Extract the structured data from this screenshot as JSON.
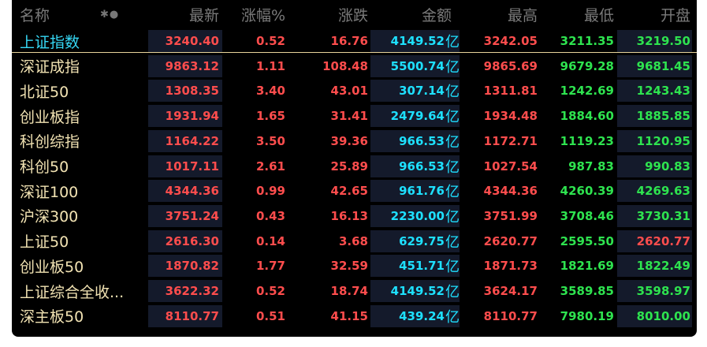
{
  "header": {
    "name": "名称",
    "toggle_icon_text": "✱●",
    "latest": "最新",
    "pct": "涨幅%",
    "change": "涨跌",
    "amount": "金额",
    "high": "最高",
    "low": "最低",
    "open": "开盘"
  },
  "unit": "亿",
  "colors": {
    "background": "#000000",
    "red": "#ff4d4d",
    "green": "#2ee34f",
    "cyan": "#1ee0ff",
    "name": "#f2e3b3",
    "highlight_name": "#36d8f5"
  },
  "rows": [
    {
      "name": "上证指数",
      "latest": "3240.40",
      "pct": "0.52",
      "change": "16.76",
      "amount": "4149.52",
      "high": "3242.05",
      "low": "3211.35",
      "open": "3219.50",
      "selected": true
    },
    {
      "name": "深证成指",
      "latest": "9863.12",
      "pct": "1.11",
      "change": "108.48",
      "amount": "5500.74",
      "high": "9865.69",
      "low": "9679.28",
      "open": "9681.45"
    },
    {
      "name": "北证50",
      "latest": "1308.35",
      "pct": "3.40",
      "change": "43.01",
      "amount": "307.14",
      "high": "1311.81",
      "low": "1242.69",
      "open": "1243.43"
    },
    {
      "name": "创业板指",
      "latest": "1931.94",
      "pct": "1.65",
      "change": "31.41",
      "amount": "2479.64",
      "high": "1934.48",
      "low": "1884.60",
      "open": "1885.85"
    },
    {
      "name": "科创综指",
      "latest": "1164.22",
      "pct": "3.50",
      "change": "39.36",
      "amount": "966.53",
      "high": "1172.71",
      "low": "1119.23",
      "open": "1120.95"
    },
    {
      "name": "科创50",
      "latest": "1017.11",
      "pct": "2.61",
      "change": "25.89",
      "amount": "966.53",
      "high": "1027.54",
      "low": "987.83",
      "open": "990.83"
    },
    {
      "name": "深证100",
      "latest": "4344.36",
      "pct": "0.99",
      "change": "42.65",
      "amount": "961.76",
      "high": "4344.36",
      "low": "4260.39",
      "open": "4269.63"
    },
    {
      "name": "沪深300",
      "latest": "3751.24",
      "pct": "0.43",
      "change": "16.13",
      "amount": "2230.00",
      "high": "3751.99",
      "low": "3708.46",
      "open": "3730.31"
    },
    {
      "name": "上证50",
      "latest": "2616.30",
      "pct": "0.14",
      "change": "3.68",
      "amount": "629.75",
      "high": "2620.77",
      "low": "2595.50",
      "open": "2620.77"
    },
    {
      "name": "创业板50",
      "latest": "1870.82",
      "pct": "1.77",
      "change": "32.59",
      "amount": "451.71",
      "high": "1871.73",
      "low": "1821.69",
      "open": "1822.49"
    },
    {
      "name": "上证综合全收...",
      "latest": "3622.32",
      "pct": "0.52",
      "change": "18.74",
      "amount": "4149.52",
      "high": "3624.17",
      "low": "3589.85",
      "open": "3598.97"
    },
    {
      "name": "深主板50",
      "latest": "8110.77",
      "pct": "0.51",
      "change": "41.15",
      "amount": "439.24",
      "high": "8110.77",
      "low": "7980.19",
      "open": "8010.00"
    }
  ]
}
